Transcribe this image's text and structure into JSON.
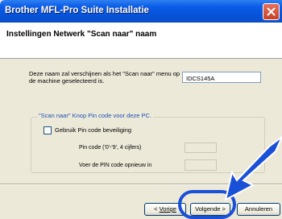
{
  "window": {
    "title": "Brother MFL-Pro Suite Installatie"
  },
  "header": {
    "title": "Instellingen Netwerk \"Scan naar\" naam"
  },
  "form": {
    "description": "Deze naam zal verschijnen als het \"Scan naar\" menu op de machine geselecteerd is.",
    "name_value": "IDCS145A"
  },
  "pin_group": {
    "legend": "\"Scan naar\" Knop Pin code voor deze PC.",
    "checkbox_label": "Gebruik Pin code beveiliging",
    "checkbox_checked": false,
    "pin_label": "Pin code ('0'-'9', 4 cijfers)",
    "pin_confirm_label": "Voer de PIN code opnieuw in"
  },
  "buttons": {
    "back_prefix": "< ",
    "back_label": "Vorige",
    "next_label": "Volgende >",
    "cancel_label": "Annuleren"
  },
  "colors": {
    "title_bar": "#0a5ce8",
    "highlight": "#1a4fd8",
    "arrow": "#1a4fd8"
  },
  "icons": {
    "close": "close-icon",
    "arrow": "pointer-arrow"
  }
}
